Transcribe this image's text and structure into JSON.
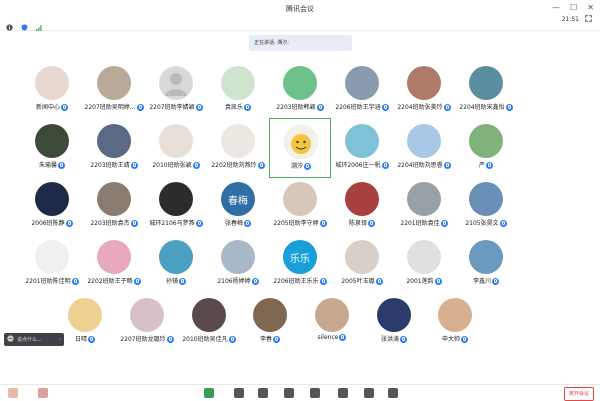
{
  "window": {
    "title": "腾讯会议",
    "time": "21:51"
  },
  "speaking": {
    "text": "正在讲话: 溯汐;"
  },
  "chat_hint": {
    "placeholder": "说点什么..."
  },
  "toolbar": {
    "leave_label": "离开会议"
  },
  "participants": [
    {
      "name": "新闻中心",
      "color": "#e9d8d2"
    },
    {
      "name": "2207班助吴明婷...",
      "color": "#b9a996"
    },
    {
      "name": "2207班助李婧颖",
      "color": "#d9d9d9"
    },
    {
      "name": "袁凯乐",
      "color": "#cfe3cf"
    },
    {
      "name": "2203班助韩颖",
      "color": "#6cc28a"
    },
    {
      "name": "2206班助王宇涵",
      "color": "#8a9bb0"
    },
    {
      "name": "2204班助张美玲",
      "color": "#b07a6a"
    },
    {
      "name": "2204班助宋鑫怡",
      "color": "#5b8fa0"
    },
    {
      "name": "朱瑜馨",
      "color": "#3d4a3a"
    },
    {
      "name": "2203班助王靖",
      "color": "#5a6a82"
    },
    {
      "name": "2010班助张颖",
      "color": "#e8e0d8"
    },
    {
      "name": "2202班助刘燕玲",
      "color": "#ece7e0"
    },
    {
      "name": "溯汐",
      "color": "#e6c56a"
    },
    {
      "name": "城环2006庄一帆",
      "color": "#7ec2d8"
    },
    {
      "name": "2204班助刘思睿",
      "color": "#a7c8e6"
    },
    {
      "name": "严",
      "color": "#7fb37a"
    },
    {
      "name": "2006班陈静",
      "color": "#1f2a4a"
    },
    {
      "name": "2203班助袁杰",
      "color": "#8a7c70"
    },
    {
      "name": "城环2106马梦燕",
      "color": "#2c2c2c"
    },
    {
      "name": "张春梅",
      "color": "#2f6fa5"
    },
    {
      "name": "2205班助李守婷",
      "color": "#d8c7b8"
    },
    {
      "name": "陈泉铎",
      "color": "#a84040"
    },
    {
      "name": "2201班助袁佳",
      "color": "#9aa0a8"
    },
    {
      "name": "2105张昊文",
      "color": "#6a90b8"
    },
    {
      "name": "2201班助陈佳明",
      "color": "#f0f0f0"
    },
    {
      "name": "2202班助王子畅",
      "color": "#e8a8c0"
    },
    {
      "name": "孙镜",
      "color": "#4aa0c0"
    },
    {
      "name": "2106杨婷婷",
      "color": "#a8b8c8"
    },
    {
      "name": "2206班助王乐乐",
      "color": "#1aa0d8"
    },
    {
      "name": "2005叶玉璐",
      "color": "#d8d0c8"
    },
    {
      "name": "2001莲韵",
      "color": "#e0e0e0"
    },
    {
      "name": "李鑫川",
      "color": "#6a9ac0"
    },
    {
      "name": "日晴",
      "color": "#f0d090"
    },
    {
      "name": "2207班助龙璐玲",
      "color": "#d8c0c8"
    },
    {
      "name": "2010班助吴佳凡",
      "color": "#5a4a4a"
    },
    {
      "name": "李春",
      "color": "#806850"
    },
    {
      "name": "silence",
      "color": "#c8a890"
    },
    {
      "name": "张洪涛",
      "color": "#2a3a6a"
    },
    {
      "name": "申大帅",
      "color": "#d8b090"
    }
  ],
  "avatar_text": {
    "zhangchunmei": "春梅",
    "lele": "乐乐"
  },
  "colors": {
    "accent": "#2d7cf6",
    "active_border": "#4caf63",
    "leave": "#e54545"
  }
}
